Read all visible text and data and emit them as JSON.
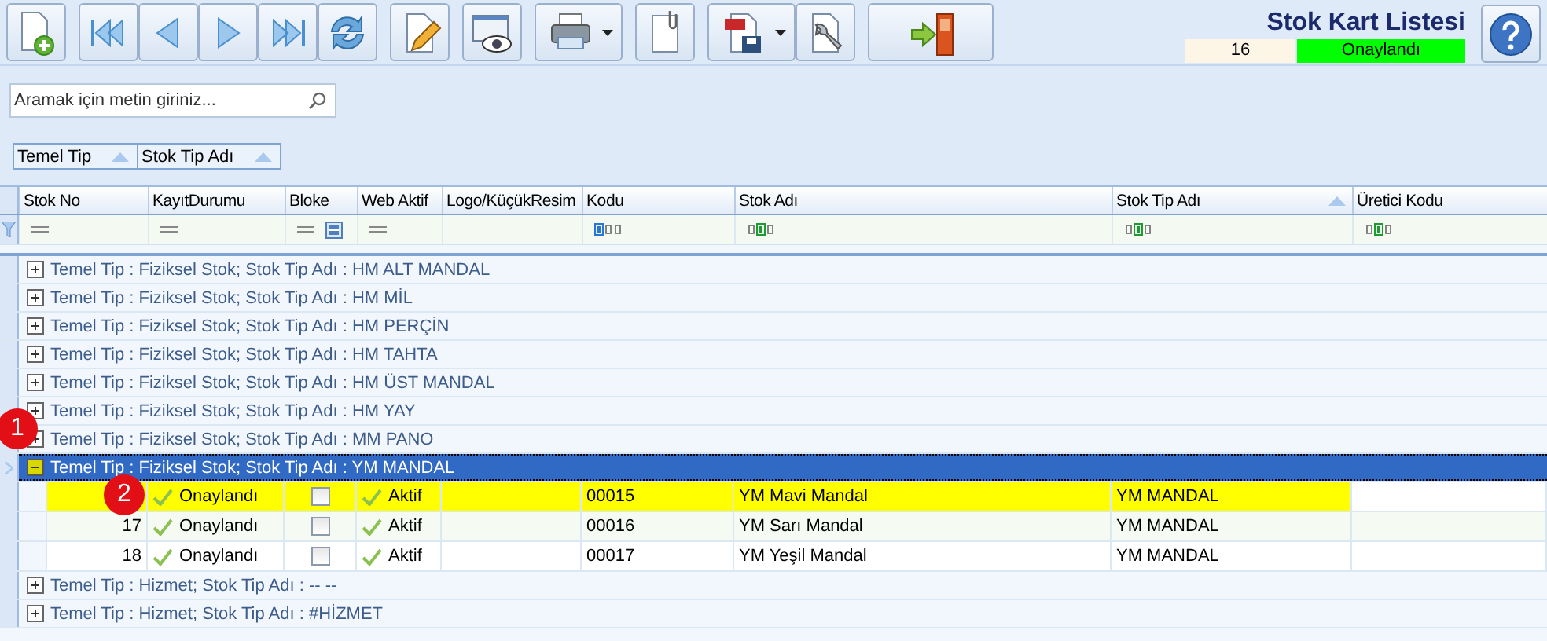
{
  "toolbar": {
    "buttons": [
      {
        "kind": "new",
        "has_menu": false
      },
      {
        "kind": "first",
        "has_menu": false
      },
      {
        "kind": "prev",
        "has_menu": false
      },
      {
        "kind": "next",
        "has_menu": false
      },
      {
        "kind": "last",
        "has_menu": false
      },
      {
        "kind": "refresh",
        "has_menu": false
      },
      {
        "kind": "edit",
        "has_menu": false
      },
      {
        "kind": "view",
        "has_menu": false
      },
      {
        "kind": "print",
        "has_menu": true
      },
      {
        "kind": "attach",
        "has_menu": false
      },
      {
        "kind": "pdf",
        "has_menu": true
      },
      {
        "kind": "settings",
        "has_menu": false
      },
      {
        "kind": "exit",
        "has_menu": false
      }
    ]
  },
  "header": {
    "title": "Stok Kart Listesi",
    "count": "16",
    "status": "Onaylandı"
  },
  "search": {
    "placeholder": "Aramak için metin giriniz..."
  },
  "group_panel": [
    {
      "label": "Temel Tip"
    },
    {
      "label": "Stok Tip Adı"
    }
  ],
  "columns": [
    {
      "label": "Stok No",
      "sorted": false
    },
    {
      "label": "KayıtDurumu",
      "sorted": false
    },
    {
      "label": "Bloke",
      "sorted": false
    },
    {
      "label": "Web Aktif",
      "sorted": false
    },
    {
      "label": "Logo/KüçükResim",
      "sorted": false
    },
    {
      "label": "Kodu",
      "sorted": false
    },
    {
      "label": "Stok Adı",
      "sorted": false
    },
    {
      "label": "Stok Tip Adı",
      "sorted": true
    },
    {
      "label": "Üretici Kodu",
      "sorted": false
    }
  ],
  "filter_row": [
    {
      "kind": "equals"
    },
    {
      "kind": "equals"
    },
    {
      "kind": "equals_check"
    },
    {
      "kind": "equals"
    },
    {
      "kind": "none"
    },
    {
      "kind": "begins"
    },
    {
      "kind": "contains"
    },
    {
      "kind": "contains"
    },
    {
      "kind": "contains"
    }
  ],
  "groups": [
    {
      "label": "Temel Tip : Fiziksel Stok;  Stok Tip Adı : HM ALT MANDAL",
      "expanded": false,
      "selected": false
    },
    {
      "label": "Temel Tip : Fiziksel Stok;  Stok Tip Adı : HM MİL",
      "expanded": false,
      "selected": false
    },
    {
      "label": "Temel Tip : Fiziksel Stok;  Stok Tip Adı : HM PERÇİN",
      "expanded": false,
      "selected": false
    },
    {
      "label": "Temel Tip : Fiziksel Stok;  Stok Tip Adı : HM TAHTA",
      "expanded": false,
      "selected": false
    },
    {
      "label": "Temel Tip : Fiziksel Stok;  Stok Tip Adı : HM ÜST MANDAL",
      "expanded": false,
      "selected": false
    },
    {
      "label": "Temel Tip : Fiziksel Stok;  Stok Tip Adı : HM YAY",
      "expanded": false,
      "selected": false
    },
    {
      "label": "Temel Tip : Fiziksel Stok;  Stok Tip Adı : MM PANO",
      "expanded": false,
      "selected": false,
      "callout": "1"
    },
    {
      "label": "Temel Tip : Fiziksel Stok;  Stok Tip Adı : YM MANDAL",
      "expanded": true,
      "selected": true,
      "rows": [
        {
          "kayit_durumu": "Onaylandı",
          "bloke": false,
          "web_aktif": "Aktif",
          "kodu": "00015",
          "stok_adi": "YM Mavi Mandal",
          "stok_tip_adi": "YM MANDAL",
          "highlighted": true,
          "callout": "2"
        },
        {
          "stok_no": "17",
          "kayit_durumu": "Onaylandı",
          "bloke": false,
          "web_aktif": "Aktif",
          "kodu": "00016",
          "stok_adi": "YM Sarı Mandal",
          "stok_tip_adi": "YM MANDAL",
          "highlighted": false
        },
        {
          "stok_no": "18",
          "kayit_durumu": "Onaylandı",
          "bloke": false,
          "web_aktif": "Aktif",
          "kodu": "00017",
          "stok_adi": "YM Yeşil Mandal",
          "stok_tip_adi": "YM MANDAL",
          "highlighted": false
        }
      ]
    },
    {
      "label": "Temel Tip : Hizmet;  Stok Tip Adı : -- --",
      "expanded": false,
      "selected": false
    },
    {
      "label": "Temel Tip : Hizmet;  Stok Tip Adı : #HİZMET",
      "expanded": false,
      "selected": false
    }
  ]
}
